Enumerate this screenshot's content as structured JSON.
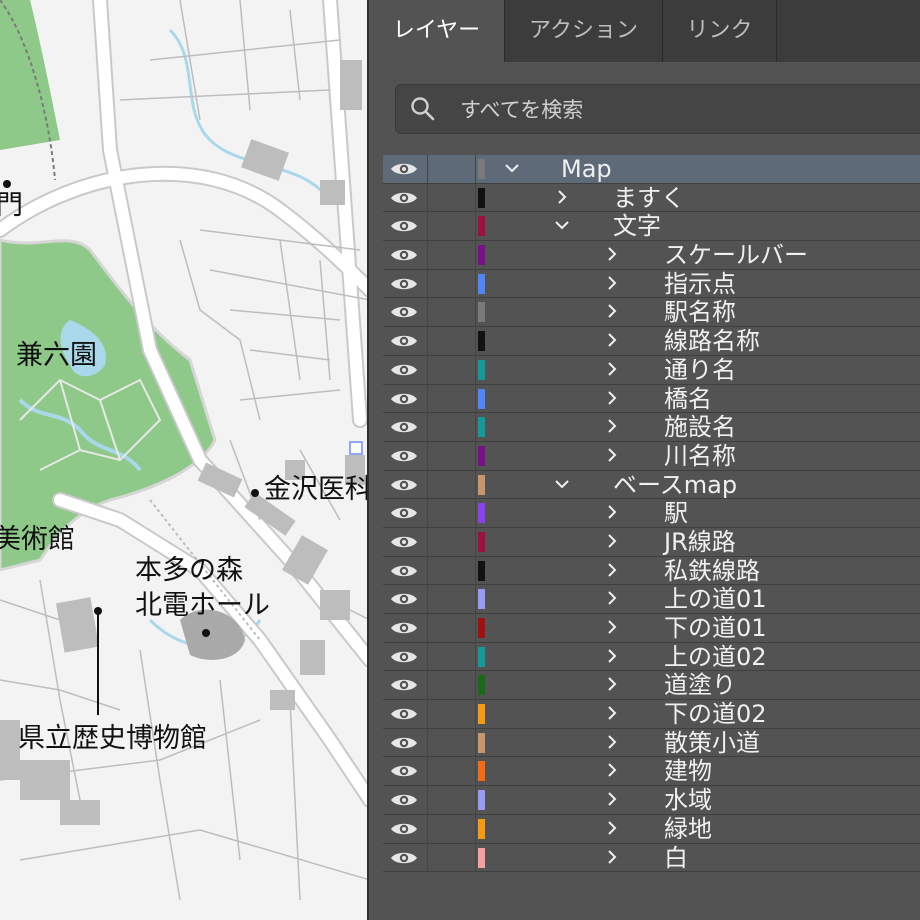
{
  "map": {
    "labels": [
      {
        "id": "gate",
        "text": "門"
      },
      {
        "id": "kenrokuen",
        "text": "兼六園"
      },
      {
        "id": "kanazawa-hospital",
        "text": "金沢医科"
      },
      {
        "id": "art-museum",
        "text": "美術館"
      },
      {
        "id": "honda-line1",
        "text": "本多の森"
      },
      {
        "id": "honda-line2",
        "text": "北電ホール"
      },
      {
        "id": "history-museum",
        "text": "県立歴史博物館"
      }
    ],
    "colors": {
      "background": "#f3f3f3",
      "park": "#8fc98a",
      "road": "#ffffff",
      "road_edge": "#c9c9c9",
      "water": "#a9d8ea",
      "building": "#bdbdbd",
      "rail": "#7a7a7a"
    }
  },
  "panel": {
    "tabs": [
      {
        "label": "レイヤー",
        "active": true
      },
      {
        "label": "アクション",
        "active": false
      },
      {
        "label": "リンク",
        "active": false
      }
    ],
    "search": {
      "placeholder": "すべてを検索",
      "icon": "search-icon"
    },
    "layers": [
      {
        "name": "Map",
        "level": 0,
        "expanded": true,
        "color": "#7a7a7a",
        "selected": true
      },
      {
        "name": "ますく",
        "level": 1,
        "expanded": false,
        "color": "#111111"
      },
      {
        "name": "文字",
        "level": 1,
        "expanded": true,
        "color": "#a0103c"
      },
      {
        "name": "スケールバー",
        "level": 2,
        "expanded": false,
        "color": "#7a0f8a"
      },
      {
        "name": "指示点",
        "level": 2,
        "expanded": false,
        "color": "#4f86f7"
      },
      {
        "name": "駅名称",
        "level": 2,
        "expanded": false,
        "color": "#7a7a7a"
      },
      {
        "name": "線路名称",
        "level": 2,
        "expanded": false,
        "color": "#111111"
      },
      {
        "name": "通り名",
        "level": 2,
        "expanded": false,
        "color": "#149a9a"
      },
      {
        "name": "橋名",
        "level": 2,
        "expanded": false,
        "color": "#4f86f7"
      },
      {
        "name": "施設名",
        "level": 2,
        "expanded": false,
        "color": "#149a9a"
      },
      {
        "name": "川名称",
        "level": 2,
        "expanded": false,
        "color": "#7a0f8a"
      },
      {
        "name": "ベースmap",
        "level": 1,
        "expanded": true,
        "color": "#c9956a"
      },
      {
        "name": "駅",
        "level": 2,
        "expanded": false,
        "color": "#8a3ff2"
      },
      {
        "name": "JR線路",
        "level": 2,
        "expanded": false,
        "color": "#a0103c"
      },
      {
        "name": "私鉄線路",
        "level": 2,
        "expanded": false,
        "color": "#111111"
      },
      {
        "name": "上の道01",
        "level": 2,
        "expanded": false,
        "color": "#9a9af5"
      },
      {
        "name": "下の道01",
        "level": 2,
        "expanded": false,
        "color": "#a01010"
      },
      {
        "name": "上の道02",
        "level": 2,
        "expanded": false,
        "color": "#149a9a"
      },
      {
        "name": "道塗り",
        "level": 2,
        "expanded": false,
        "color": "#1a6a1a"
      },
      {
        "name": "下の道02",
        "level": 2,
        "expanded": false,
        "color": "#f59b12"
      },
      {
        "name": "散策小道",
        "level": 2,
        "expanded": false,
        "color": "#c9956a"
      },
      {
        "name": "建物",
        "level": 2,
        "expanded": false,
        "color": "#f56a12"
      },
      {
        "name": "水域",
        "level": 2,
        "expanded": false,
        "color": "#9a9af5"
      },
      {
        "name": "緑地",
        "level": 2,
        "expanded": false,
        "color": "#f59b12"
      },
      {
        "name": "白",
        "level": 2,
        "expanded": false,
        "color": "#f5a0a0"
      }
    ]
  }
}
